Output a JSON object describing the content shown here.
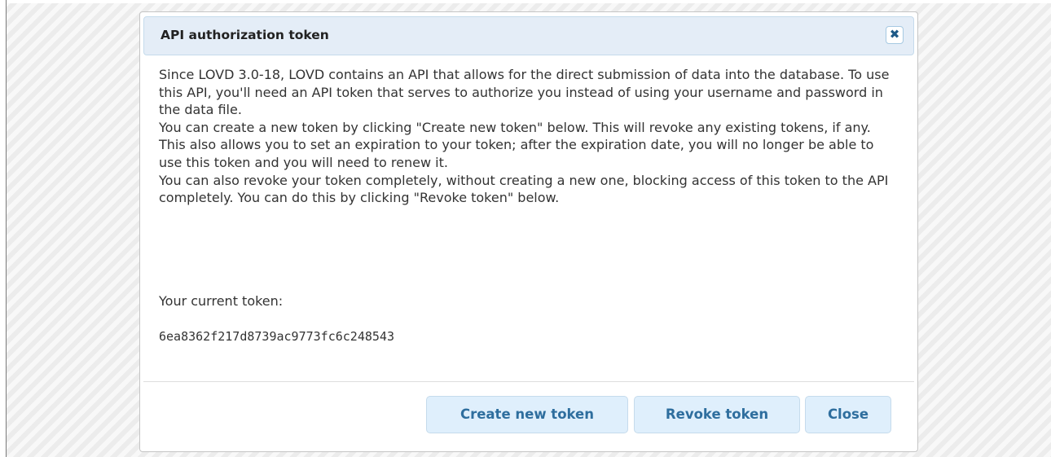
{
  "dialog": {
    "title": "API authorization token",
    "close_icon_glyph": "✖",
    "paragraphs": [
      "Since LOVD 3.0-18, LOVD contains an API that allows for the direct submission of data into the database. To use this API, you'll need an API token that serves to authorize you instead of using your username and password in the data file.",
      "You can create a new token by clicking \"Create new token\" below. This will revoke any existing tokens, if any. This also allows you to set an expiration to your token; after the expiration date, you will no longer be able to use this token and you will need to renew it.",
      "You can also revoke your token completely, without creating a new one, blocking access of this token to the API completely. You can do this by clicking \"Revoke token\" below."
    ],
    "token_label": "Your current token:",
    "token_value": "6ea8362f217d8739ac9773fc6c248543",
    "buttons": {
      "create": "Create new token",
      "revoke": "Revoke token",
      "close": "Close"
    }
  },
  "colors": {
    "titlebar_bg": "#e4edf7",
    "button_bg": "#dfeffc",
    "button_text": "#2e6e9e",
    "close_icon": "#1d5987"
  },
  "icons": {
    "close": "close-icon"
  }
}
